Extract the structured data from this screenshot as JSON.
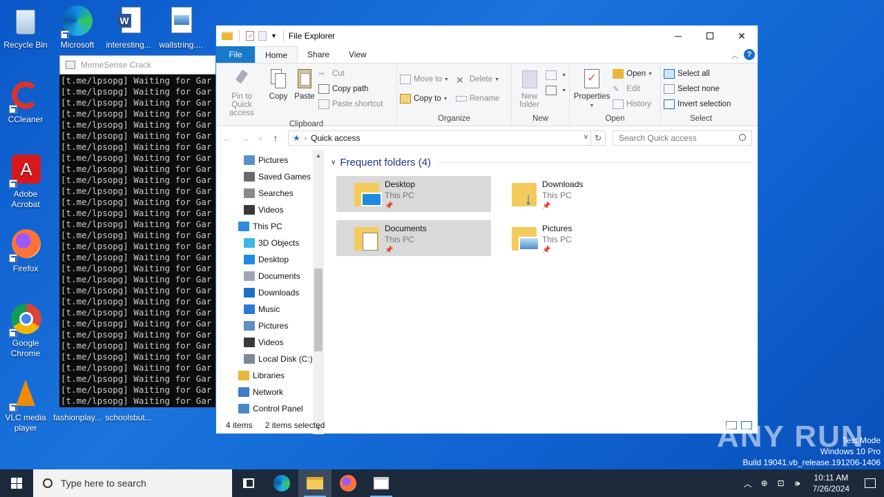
{
  "desktop": {
    "icons": [
      {
        "label": "Recycle Bin"
      },
      {
        "label": "Microsoft Edge"
      },
      {
        "label": "interesting..."
      },
      {
        "label": "wallstring...."
      },
      {
        "label": "CCleaner"
      },
      {
        "label": "Adobe Acrobat"
      },
      {
        "label": "Firefox"
      },
      {
        "label": "Google Chrome"
      },
      {
        "label": "VLC media player"
      },
      {
        "label": "fashionplay..."
      },
      {
        "label": "schoolsbut..."
      }
    ]
  },
  "console": {
    "title": "MemeSense Crack",
    "line": "[t.me/lpsopg] Waiting for Gar",
    "line_count": 30
  },
  "explorer": {
    "title": "File Explorer",
    "tabs": [
      "File",
      "Home",
      "Share",
      "View"
    ],
    "ribbon": {
      "clipboard": {
        "label": "Clipboard",
        "pin": "Pin to Quick access",
        "copy": "Copy",
        "paste": "Paste",
        "cut": "Cut",
        "copy_path": "Copy path",
        "paste_shortcut": "Paste shortcut"
      },
      "organize": {
        "label": "Organize",
        "move_to": "Move to",
        "copy_to": "Copy to",
        "delete": "Delete",
        "rename": "Rename"
      },
      "new": {
        "label": "New",
        "new_folder": "New folder"
      },
      "open": {
        "label": "Open",
        "properties": "Properties",
        "open": "Open",
        "edit": "Edit",
        "history": "History"
      },
      "select": {
        "label": "Select",
        "select_all": "Select all",
        "select_none": "Select none",
        "invert": "Invert selection"
      }
    },
    "address": {
      "path": "Quick access",
      "search_placeholder": "Search Quick access"
    },
    "nav": [
      {
        "label": "Pictures",
        "indent": 1,
        "icon": "pictures-icon"
      },
      {
        "label": "Saved Games",
        "indent": 1,
        "icon": "saved-games-icon"
      },
      {
        "label": "Searches",
        "indent": 1,
        "icon": "searches-icon"
      },
      {
        "label": "Videos",
        "indent": 1,
        "icon": "videos-icon"
      },
      {
        "label": "This PC",
        "indent": 0,
        "icon": "this-pc-icon"
      },
      {
        "label": "3D Objects",
        "indent": 1,
        "icon": "3d-objects-icon"
      },
      {
        "label": "Desktop",
        "indent": 1,
        "icon": "desktop-icon"
      },
      {
        "label": "Documents",
        "indent": 1,
        "icon": "documents-icon"
      },
      {
        "label": "Downloads",
        "indent": 1,
        "icon": "downloads-icon"
      },
      {
        "label": "Music",
        "indent": 1,
        "icon": "music-icon"
      },
      {
        "label": "Pictures",
        "indent": 1,
        "icon": "pictures-icon"
      },
      {
        "label": "Videos",
        "indent": 1,
        "icon": "videos-icon"
      },
      {
        "label": "Local Disk (C:)",
        "indent": 1,
        "icon": "local-disk-icon"
      },
      {
        "label": "Libraries",
        "indent": 0,
        "icon": "libraries-icon"
      },
      {
        "label": "Network",
        "indent": 0,
        "icon": "network-icon"
      },
      {
        "label": "Control Panel",
        "indent": 0,
        "icon": "control-panel-icon"
      }
    ],
    "section_title": "Frequent folders (4)",
    "folders": [
      {
        "name": "Desktop",
        "location": "This PC",
        "selected": true
      },
      {
        "name": "Downloads",
        "location": "This PC",
        "selected": false
      },
      {
        "name": "Documents",
        "location": "This PC",
        "selected": true
      },
      {
        "name": "Pictures",
        "location": "This PC",
        "selected": false
      }
    ],
    "status": {
      "items": "4 items",
      "selected": "2 items selected"
    }
  },
  "taskbar": {
    "search_placeholder": "Type here to search",
    "time": "10:11 AM",
    "date": "7/26/2024"
  },
  "watermark": {
    "line1": "Test Mode",
    "line2": "Windows 10 Pro",
    "line3": "Build 19041.vb_release.191206-1406",
    "brand": "ANY RUN"
  },
  "colors": {
    "accent": "#1979ca",
    "desktop": "#0f62d0",
    "taskbar": "#1c2a3c"
  }
}
